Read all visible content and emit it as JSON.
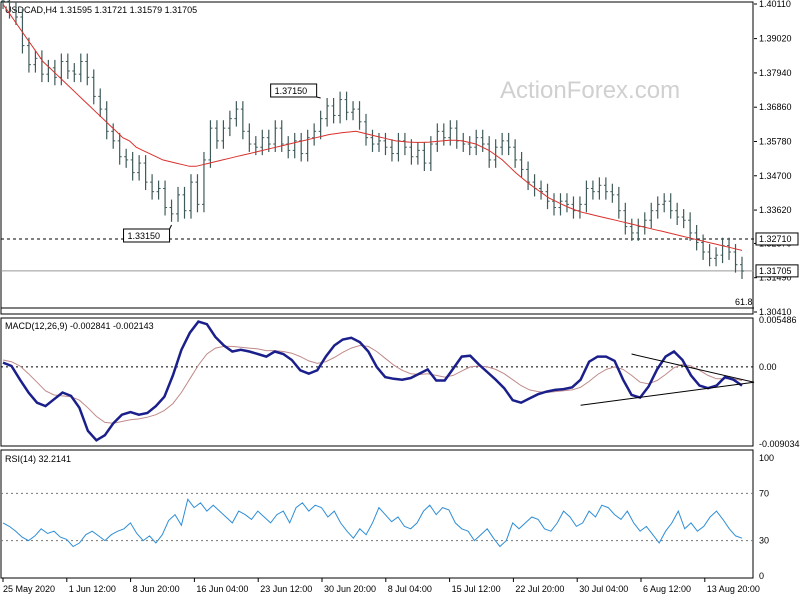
{
  "chart_data": [
    {
      "type": "line",
      "header": "USDCAD,H4  1.31595 1.31721 1.31579 1.31705",
      "watermark": "ActionForex.com",
      "yticks": [
        "1.40110",
        "1.39020",
        "1.37940",
        "1.36860",
        "1.35780",
        "1.34700",
        "1.33620",
        "1.32570",
        "1.31490",
        "1.30410"
      ],
      "ytick_values": [
        1.4011,
        1.3902,
        1.3794,
        1.3686,
        1.3578,
        1.347,
        1.3362,
        1.3257,
        1.3149,
        1.3041
      ],
      "ylim": [
        1.3041,
        1.4011
      ],
      "level_dashed": {
        "value": 1.3271,
        "label": "1.32710"
      },
      "level_solid": {
        "value": 1.31705,
        "label": "1.31705"
      },
      "fib_label": "61.8",
      "annotations": [
        {
          "label": "1.37150",
          "value": 1.3715,
          "idx": 49
        },
        {
          "label": "1.33150",
          "value": 1.3315,
          "idx": 26
        }
      ],
      "price": [
        1.402,
        1.399,
        1.397,
        1.388,
        1.382,
        1.384,
        1.379,
        1.381,
        1.378,
        1.383,
        1.38,
        1.379,
        1.383,
        1.378,
        1.372,
        1.368,
        1.361,
        1.358,
        1.353,
        1.352,
        1.348,
        1.351,
        1.345,
        1.342,
        1.343,
        1.337,
        1.335,
        1.341,
        1.336,
        1.345,
        1.338,
        1.352,
        1.362,
        1.358,
        1.362,
        1.365,
        1.368,
        1.361,
        1.357,
        1.356,
        1.359,
        1.357,
        1.362,
        1.357,
        1.355,
        1.358,
        1.354,
        1.359,
        1.361,
        1.365,
        1.369,
        1.366,
        1.371,
        1.367,
        1.368,
        1.364,
        1.359,
        1.357,
        1.358,
        1.356,
        1.354,
        1.358,
        1.356,
        1.353,
        1.355,
        1.351,
        1.357,
        1.361,
        1.359,
        1.362,
        1.358,
        1.357,
        1.356,
        1.359,
        1.357,
        1.352,
        1.356,
        1.358,
        1.356,
        1.352,
        1.349,
        1.345,
        1.343,
        1.342,
        1.339,
        1.337,
        1.339,
        1.338,
        1.336,
        1.338,
        1.343,
        1.342,
        1.344,
        1.342,
        1.341,
        1.336,
        1.331,
        1.329,
        1.331,
        1.333,
        1.336,
        1.338,
        1.339,
        1.336,
        1.334,
        1.333,
        1.329,
        1.326,
        1.323,
        1.321,
        1.322,
        1.325,
        1.323,
        1.319,
        1.317
      ],
      "ma": [
        1.401,
        1.398,
        1.395,
        1.392,
        1.389,
        1.386,
        1.383,
        1.381,
        1.379,
        1.377,
        1.375,
        1.373,
        1.371,
        1.369,
        1.367,
        1.365,
        1.363,
        1.361,
        1.359,
        1.358,
        1.356,
        1.355,
        1.354,
        1.353,
        1.352,
        1.3515,
        1.351,
        1.3505,
        1.35,
        1.35,
        1.3505,
        1.351,
        1.3515,
        1.352,
        1.3525,
        1.353,
        1.3535,
        1.354,
        1.3545,
        1.355,
        1.3555,
        1.356,
        1.3565,
        1.357,
        1.3575,
        1.358,
        1.3585,
        1.359,
        1.3595,
        1.36,
        1.3603,
        1.3606,
        1.3608,
        1.361,
        1.3605,
        1.36,
        1.3595,
        1.359,
        1.3585,
        1.358,
        1.3578,
        1.3576,
        1.3575,
        1.3575,
        1.3576,
        1.3578,
        1.358,
        1.3582,
        1.3582,
        1.358,
        1.3575,
        1.357,
        1.356,
        1.355,
        1.3535,
        1.352,
        1.35,
        1.348,
        1.3462,
        1.3445,
        1.343,
        1.3415,
        1.34,
        1.339,
        1.338,
        1.337,
        1.3362,
        1.3355,
        1.335,
        1.3345,
        1.334,
        1.3335,
        1.333,
        1.3325,
        1.332,
        1.3315,
        1.331,
        1.3305,
        1.33,
        1.3295,
        1.329,
        1.3285,
        1.328,
        1.3275,
        1.327,
        1.3265,
        1.326,
        1.3255,
        1.325,
        1.3245,
        1.324,
        1.3235
      ]
    },
    {
      "type": "line",
      "header": "MACD(12,26,9) -0.002841 -0.002143",
      "yticks": [
        "0.005486",
        "0.00",
        "-0.009034"
      ],
      "ytick_values": [
        0.005486,
        0.0,
        -0.009034
      ],
      "ylim": [
        -0.009034,
        0.005486
      ],
      "macd": [
        0.0005,
        0.0001,
        -0.0015,
        -0.003,
        -0.0042,
        -0.0046,
        -0.0038,
        -0.003,
        -0.0034,
        -0.0048,
        -0.0075,
        -0.0086,
        -0.008,
        -0.0066,
        -0.0056,
        -0.0053,
        -0.0056,
        -0.0054,
        -0.0046,
        -0.0035,
        -0.001,
        0.002,
        0.004,
        0.0053,
        0.005,
        0.0035,
        0.0025,
        0.0018,
        0.002,
        0.0018,
        0.0015,
        0.0012,
        0.0018,
        0.0015,
        0.0008,
        -0.0004,
        -0.0008,
        -0.0004,
        0.0012,
        0.0025,
        0.0032,
        0.0034,
        0.0029,
        0.0018,
        0.0,
        -0.0012,
        -0.0014,
        -0.0015,
        -0.0013,
        -0.0008,
        -0.0003,
        -0.0016,
        -0.0016,
        -0.0002,
        0.0012,
        0.0013,
        0.0003,
        -0.0006,
        -0.0015,
        -0.0025,
        -0.0039,
        -0.0042,
        -0.0037,
        -0.0032,
        -0.0029,
        -0.0027,
        -0.0026,
        -0.0024,
        -0.0015,
        0.0006,
        0.0012,
        0.0012,
        0.0007,
        -0.0015,
        -0.0033,
        -0.0036,
        -0.0023,
        -0.0003,
        0.0012,
        0.0018,
        0.0008,
        -0.001,
        -0.0022,
        -0.0025,
        -0.0022,
        -0.0012,
        -0.0015,
        -0.0022
      ],
      "signal": [
        0.0008,
        0.0006,
        0.0001,
        -0.0008,
        -0.0018,
        -0.0028,
        -0.0033,
        -0.0034,
        -0.0035,
        -0.0039,
        -0.0048,
        -0.0058,
        -0.0065,
        -0.0066,
        -0.0064,
        -0.0062,
        -0.0061,
        -0.0059,
        -0.0056,
        -0.0051,
        -0.0043,
        -0.003,
        -0.0014,
        0.0002,
        0.0015,
        0.0022,
        0.0024,
        0.0024,
        0.0023,
        0.0022,
        0.0021,
        0.0019,
        0.0019,
        0.0018,
        0.0016,
        0.0012,
        0.0007,
        0.0004,
        0.0006,
        0.0011,
        0.0017,
        0.0022,
        0.0025,
        0.0024,
        0.0018,
        0.001,
        0.0002,
        -0.0004,
        -0.0008,
        -0.0009,
        -0.0008,
        -0.001,
        -0.0012,
        -0.001,
        -0.0005,
        0.0,
        0.0001,
        0.0,
        -0.0003,
        -0.0008,
        -0.0015,
        -0.0022,
        -0.0027,
        -0.0029,
        -0.003,
        -0.0029,
        -0.0028,
        -0.0027,
        -0.0024,
        -0.0017,
        -0.0009,
        -0.0003,
        0.0,
        -0.0003,
        -0.001,
        -0.0018,
        -0.002,
        -0.0016,
        -0.0009,
        -0.0001,
        0.0003,
        0.0001,
        -0.0004,
        -0.001,
        -0.0014,
        -0.0014,
        -0.0014,
        -0.0016
      ],
      "trendline_upper": {
        "from": [
          74,
          0.0015
        ],
        "to": [
          87,
          -0.0018
        ]
      },
      "trendline_lower": {
        "from": [
          68,
          -0.0045
        ],
        "to": [
          87,
          -0.0018
        ]
      }
    },
    {
      "type": "line",
      "header": "RSI(14) 32.2141",
      "yticks": [
        "100",
        "70",
        "30",
        "0"
      ],
      "ytick_values": [
        100,
        70,
        30,
        0
      ],
      "ylim": [
        0,
        100
      ],
      "levels": [
        70,
        30
      ],
      "rsi": [
        45,
        42,
        38,
        33,
        30,
        34,
        40,
        36,
        38,
        33,
        31,
        25,
        28,
        35,
        38,
        34,
        30,
        35,
        38,
        40,
        45,
        36,
        30,
        34,
        28,
        35,
        47,
        52,
        43,
        65,
        58,
        62,
        55,
        60,
        55,
        50,
        45,
        55,
        52,
        48,
        55,
        50,
        45,
        52,
        55,
        45,
        58,
        62,
        55,
        60,
        58,
        50,
        55,
        45,
        38,
        32,
        40,
        35,
        45,
        58,
        52,
        46,
        50,
        42,
        40,
        45,
        55,
        60,
        52,
        58,
        56,
        45,
        40,
        38,
        30,
        35,
        40,
        32,
        25,
        30,
        45,
        40,
        45,
        50,
        48,
        40,
        38,
        45,
        55,
        50,
        42,
        45,
        55,
        50,
        60,
        58,
        52,
        48,
        55,
        45,
        38,
        42,
        35,
        28,
        38,
        45,
        55,
        40,
        45,
        38,
        42,
        50,
        55,
        48,
        40,
        34,
        32
      ],
      "xticks": [
        "25 May 2020",
        "1 Jun 12:00",
        "8 Jun 20:00",
        "16 Jun 04:00",
        "23 Jun 12:00",
        "30 Jun 20:00",
        "8 Jul 04:00",
        "15 Jul 12:00",
        "22 Jul 20:00",
        "30 Jul 04:00",
        "6 Aug 12:00",
        "13 Aug 20:00"
      ]
    }
  ]
}
